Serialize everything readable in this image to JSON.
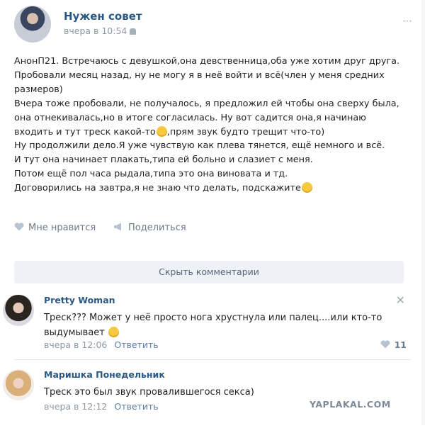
{
  "post": {
    "title": "Нужен совет",
    "time": "вчера в 10:54",
    "lines": [
      "АнонП21. Встречаюсь с девушкой,она девственница,оба уже хотим друг друга.",
      "Пробовали месяц назад, ну не могу я в неё войти и всё(член у меня средних",
      "размеров)",
      "Вчера тоже пробовали, не получалось, я предложил ей чтобы она сверху была,",
      "она отнекивалась,но в итоге согласилась. Ну вот садится она,я начинаю",
      "входить и тут треск какой-то",
      ",прям звук будто трещит что-то)",
      "Ну продолжили дело.Я уже чувствую как плева тянется, ещё немного и всё.",
      "И тут она начинает плакать,типа ей больно и слазиет с меня.",
      "Потом ещё пол часа рыдала,типа это она виновата и тд.",
      "Договорились на завтра,я не знаю что делать, подскажите"
    ],
    "like_label": "Мне нравится",
    "share_label": "Поделиться"
  },
  "hide_comments_label": "Скрыть комментарии",
  "comments": [
    {
      "name": "Pretty Woman",
      "text_line1": "Треск??? Может у неё просто нога хрустнула или палец....или кто-то",
      "text_line2": "выдумывает",
      "time": "вчера в 12:06",
      "reply": "Ответить",
      "likes": "11"
    },
    {
      "name": "Маришка Понедельник",
      "text_line1": "Треск это был звук провалившегося секса)",
      "time": "вчера в 12:12",
      "reply": "Ответить"
    }
  ],
  "watermark": "YAPLAKAL.COM",
  "colors": {
    "link": "#2a5885",
    "meta": "#8e9aa6",
    "button_bg": "#eef1f5"
  }
}
